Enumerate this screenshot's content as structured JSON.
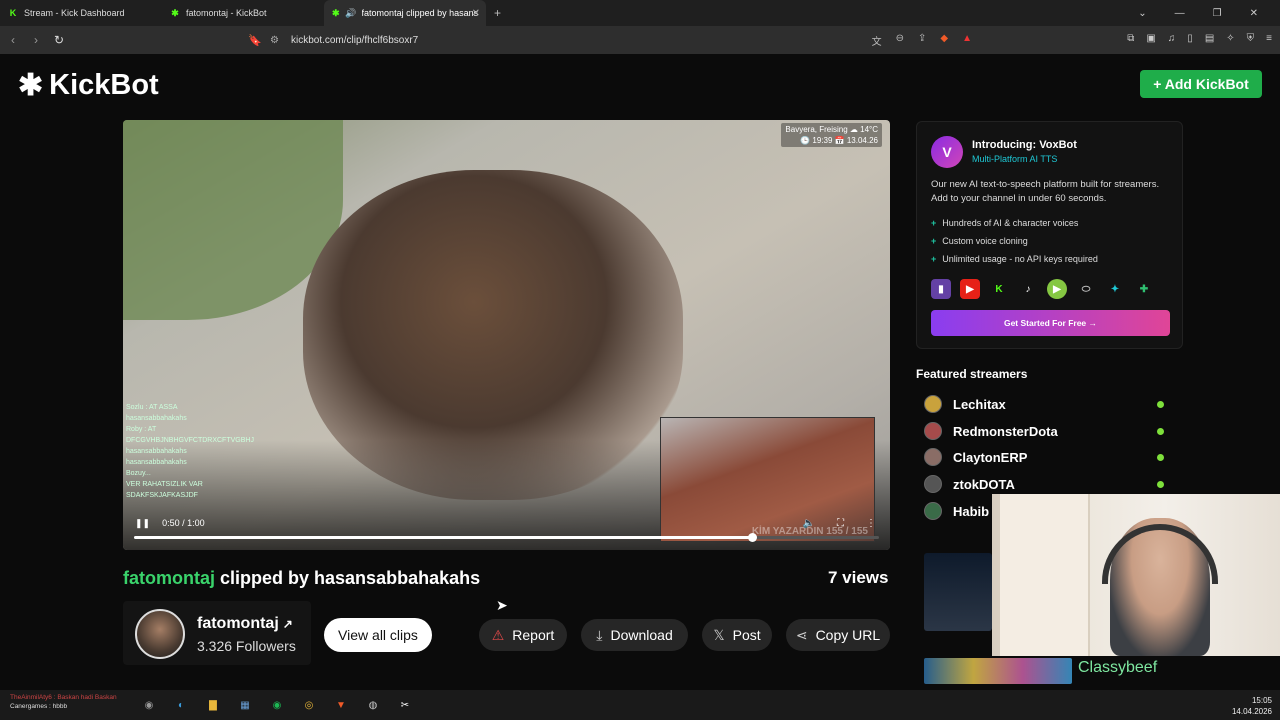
{
  "browser": {
    "tabs": [
      {
        "title": "Stream - Kick Dashboard",
        "active": false
      },
      {
        "title": "fatomontaj - KickBot",
        "active": false
      },
      {
        "title": "fatomontaj clipped by hasansabbahakahs",
        "active": true
      }
    ],
    "url": "kickbot.com/clip/fhclf6bsoxr7"
  },
  "header": {
    "logo_text": "KickBot",
    "add_button": "+ Add KickBot"
  },
  "video": {
    "weather_line1": "Bavyera, Freising ☁ 14°C",
    "weather_line2": "🕒 19:39 📅 13.04.26",
    "time": "0:50 / 1:00",
    "progress": 0.83,
    "chat_lines": [
      "Sozlu : AT ASSA",
      "hasansabbahakahs",
      "Roby : AT",
      "DFCGVHBJNBHGVFCTDRXCFTVGBHJ",
      "hasansabbahakahs",
      "hasansabbahakahs",
      "Bozuy...",
      "VER RAHATSIZLIK VAR",
      "SDAKFSKJAFKASJDF"
    ],
    "pip_watermark": "KİM YAZARDIN 155 / 155"
  },
  "clip": {
    "channel": "fatomontaj",
    "clipped_by_text": "clipped by hasansabbahakahs",
    "views": "7 views",
    "followers": "3.326 Followers",
    "view_all": "View all clips",
    "actions": {
      "report": "Report",
      "download": "Download",
      "post": "Post",
      "copy_url": "Copy URL"
    }
  },
  "promo": {
    "title": "Introducing: VoxBot",
    "subtitle": "Multi-Platform AI TTS",
    "description": "Our new AI text-to-speech platform built for streamers. Add to your channel in under 60 seconds.",
    "features": [
      "Hundreds of AI & character voices",
      "Custom voice cloning",
      "Unlimited usage - no API keys required"
    ],
    "cta": "Get Started For Free →"
  },
  "featured": {
    "heading": "Featured streamers",
    "streamers": [
      "Lechitax",
      "RedmonsterDota",
      "ClaytonERP",
      "ztokDOTA",
      "Habib"
    ]
  },
  "overlay": {
    "cam_label": "Classybeef"
  },
  "taskbar": {
    "status1": "TheAinmilAty6 : Baskan hadi Baskan",
    "status2": "Canergames : hbbb",
    "time": "15:05",
    "date": "14.04.2026"
  },
  "colors": {
    "accent": "#1fad4a",
    "channel_green": "#3ad36b",
    "cta_start": "#8a3df0",
    "cta_end": "#e04597"
  }
}
